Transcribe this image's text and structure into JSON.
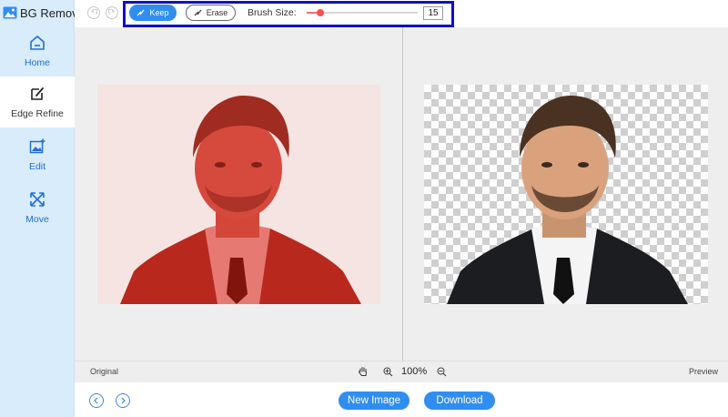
{
  "app": {
    "title": "BG Remover"
  },
  "sidebar": {
    "items": [
      {
        "label": "Home",
        "icon": "home-icon"
      },
      {
        "label": "Edge Refine",
        "icon": "edge-refine-icon"
      },
      {
        "label": "Edit",
        "icon": "edit-image-icon"
      },
      {
        "label": "Move",
        "icon": "move-arrows-icon"
      }
    ],
    "active": "Edge Refine"
  },
  "toolbar": {
    "keep_label": "Keep",
    "erase_label": "Erase",
    "brush_size_label": "Brush Size:",
    "brush_size_value": "15",
    "brush_size_fraction": 0.12
  },
  "status": {
    "original_label": "Original",
    "preview_label": "Preview",
    "zoom": "100%"
  },
  "actions": {
    "new_image_label": "New Image",
    "download_label": "Download"
  },
  "colors": {
    "accent": "#2f8ef0",
    "sidebar_bg": "#d9ecfb",
    "keep_overlay": "#d73a2c",
    "highlight_border": "#1010c8"
  }
}
